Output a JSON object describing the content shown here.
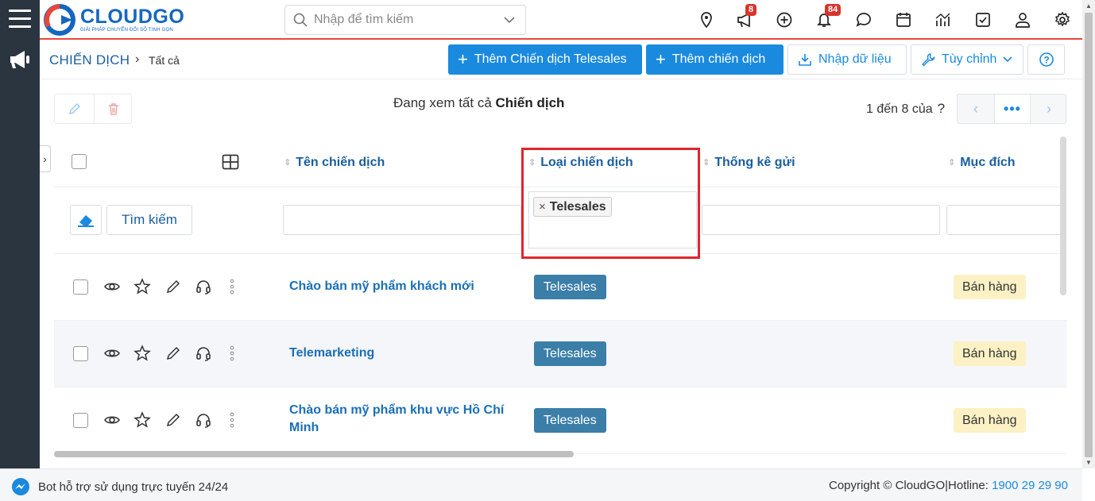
{
  "app": {
    "brand": "CLOUDGO",
    "slogan": "GIẢI PHÁP CHUYỂN ĐỔI SỐ TINH GỌN"
  },
  "header": {
    "search_placeholder": "Nhập để tìm kiếm",
    "announce_badge": "8",
    "notify_badge": "84",
    "icons": [
      "map-pin-icon",
      "megaphone-icon",
      "plus-circle-icon",
      "bell-icon",
      "chat-icon",
      "calendar-icon",
      "chart-icon",
      "checkbox-icon",
      "user-icon",
      "gear-icon"
    ]
  },
  "breadcrumb": {
    "title": "CHIẾN DỊCH",
    "separator": "›",
    "sub": "Tất cả"
  },
  "actions": {
    "add_telesales": "Thêm Chiến dịch Telesales",
    "add_campaign": "Thêm chiến dịch",
    "import": "Nhập dữ liệu",
    "customize": "Tùy chỉnh"
  },
  "listview": {
    "viewing_prefix": "Đang xem tất cả",
    "viewing_module": "Chiến dịch",
    "paging": "1 đến 8 của",
    "paging_unknown": "?",
    "pager_mid": "•••"
  },
  "table": {
    "columns": [
      "Tên chiến dịch",
      "Loại chiến dịch",
      "Thống kê gửi",
      "Mục đích"
    ],
    "search_button": "Tìm kiếm",
    "filter_chip": "Telesales",
    "rows": [
      {
        "name": "Chào bán mỹ phẩm khách mới",
        "type": "Telesales",
        "purpose": "Bán hàng"
      },
      {
        "name": "Telemarketing",
        "type": "Telesales",
        "purpose": "Bán hàng"
      },
      {
        "name": "Chào bán mỹ phẩm khu vực Hồ Chí Minh",
        "type": "Telesales",
        "purpose": "Bán hàng"
      }
    ]
  },
  "footer": {
    "bot_text": "Bot hỗ trợ sử dụng trực tuyến 24/24",
    "copyright": "Copyright © CloudGO",
    "hotline_label": "Hotline:",
    "hotline": "1900 29 29 90"
  },
  "colors": {
    "primary": "#1a8adf",
    "rail": "#2b3540",
    "header_line": "#e8473a",
    "tag_telesales": "#3b7ea8",
    "tag_sale": "#fbf1c4",
    "highlight": "#e0262c"
  }
}
